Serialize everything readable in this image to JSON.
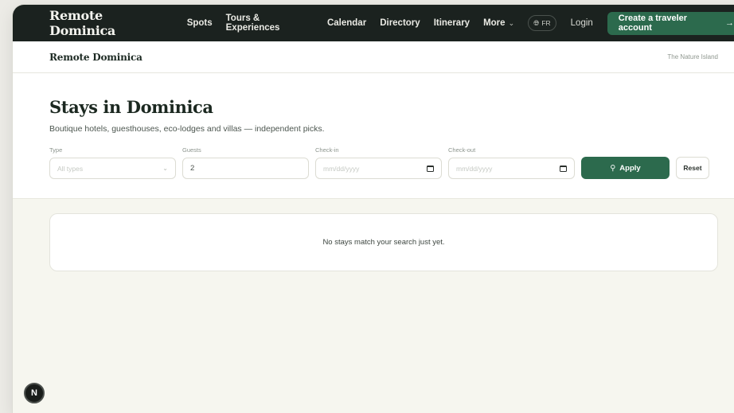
{
  "topnav": {
    "brand": "Remote Dominica",
    "links": [
      "Spots",
      "Tours & Experiences",
      "Calendar",
      "Directory",
      "Itinerary"
    ],
    "more": "More",
    "lang": "FR",
    "login": "Login",
    "cta": "Create a traveler account"
  },
  "subbar": {
    "brand": "Remote Dominica",
    "tagline": "The Nature Island"
  },
  "hero": {
    "title": "Stays in Dominica",
    "subtitle": "Boutique hotels, guesthouses, eco-lodges and villas — independent picks."
  },
  "filters": {
    "type": {
      "label": "Type",
      "value": "All types"
    },
    "guests": {
      "label": "Guests",
      "value": "2"
    },
    "checkin": {
      "label": "Check-in",
      "placeholder": "mm/dd/yyyy"
    },
    "checkout": {
      "label": "Check-out",
      "placeholder": "mm/dd/yyyy"
    },
    "apply": "Apply",
    "reset": "Reset"
  },
  "results": {
    "empty_message": "No stays match your search just yet."
  },
  "badge": {
    "letter": "N"
  },
  "colors": {
    "nav_bg": "#1b221f",
    "accent": "#2c6a4d",
    "page_bg": "#f6f6ef"
  },
  "icons": {
    "lang": "globe-icon",
    "apply": "search-icon",
    "date": "calendar-icon",
    "more": "chevron-down-icon",
    "cta": "arrow-right-icon"
  }
}
